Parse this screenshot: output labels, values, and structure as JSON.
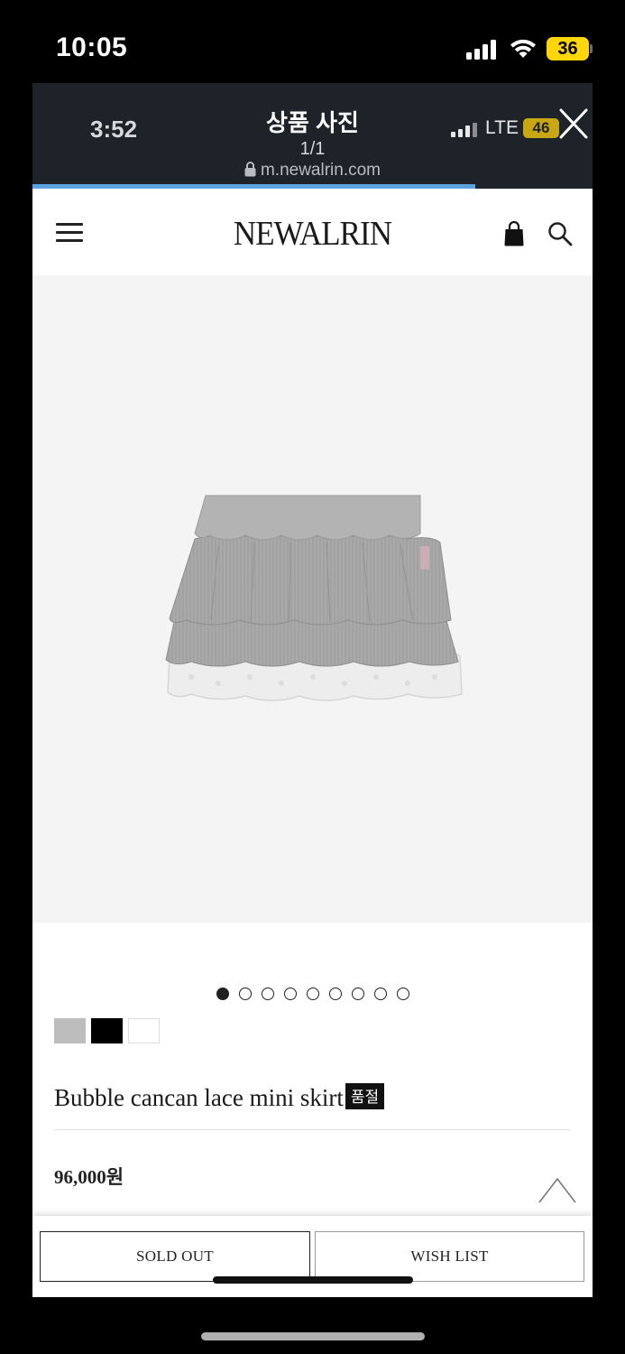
{
  "status_bar": {
    "time": "10:05",
    "battery": "36"
  },
  "viewer": {
    "time": "3:52",
    "title": "상품 사진",
    "counter": "1/1",
    "url": "m.newalrin.com",
    "network": "LTE",
    "battery": "46",
    "load_progress": 0.79
  },
  "header": {
    "logo": "NEWALRIN"
  },
  "product": {
    "image_index": 1,
    "image_count": 9,
    "swatches": [
      "#bdbdbd",
      "#000000",
      "#ffffff"
    ],
    "name": "Bubble cancan lace mini skirt",
    "badge": "품절",
    "price": "96,000원"
  },
  "actions": {
    "sold_out": "SOLD OUT",
    "wish_list": "WISH LIST"
  }
}
